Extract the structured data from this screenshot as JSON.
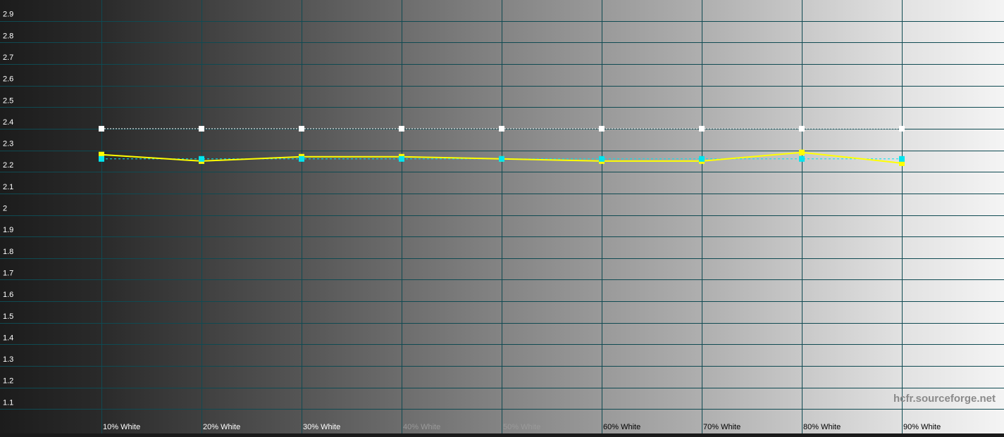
{
  "chart_data": {
    "type": "line",
    "title": "",
    "xlabel": "",
    "ylabel": "",
    "categories": [
      "10% White",
      "20% White",
      "30% White",
      "40% White",
      "50% White",
      "60% White",
      "70% White",
      "80% White",
      "90% White"
    ],
    "y_ticks": [
      "1.1",
      "1.2",
      "1.3",
      "1.4",
      "1.5",
      "1.6",
      "1.7",
      "1.8",
      "1.9",
      "2",
      "2.1",
      "2.2",
      "2.3",
      "2.4",
      "2.5",
      "2.6",
      "2.7",
      "2.8",
      "2.9"
    ],
    "ylim": [
      1.0,
      3.0
    ],
    "grid": true,
    "legend": "none",
    "background": "grayscale gradient from dark (left) to white (right)",
    "series": [
      {
        "role": "reference-2.4",
        "color": "#ffffff",
        "line_style": "dotted",
        "values": [
          2.4,
          2.4,
          2.4,
          2.4,
          2.4,
          2.4,
          2.4,
          2.4,
          2.4
        ]
      },
      {
        "role": "average",
        "color": "#00e5ee",
        "line_style": "dashed",
        "values": [
          2.26,
          2.26,
          2.26,
          2.26,
          2.26,
          2.26,
          2.26,
          2.26,
          2.26
        ]
      },
      {
        "role": "measured",
        "color": "#ffff00",
        "line_style": "solid",
        "values": [
          2.28,
          2.25,
          2.27,
          2.27,
          2.26,
          2.25,
          2.25,
          2.29,
          2.24
        ]
      }
    ]
  },
  "watermark": "hcfr.sourceforge.net",
  "colors": {
    "grid": "#0f4a52",
    "reference": "#ffffff",
    "average": "#00e5ee",
    "measured": "#ffff00"
  }
}
